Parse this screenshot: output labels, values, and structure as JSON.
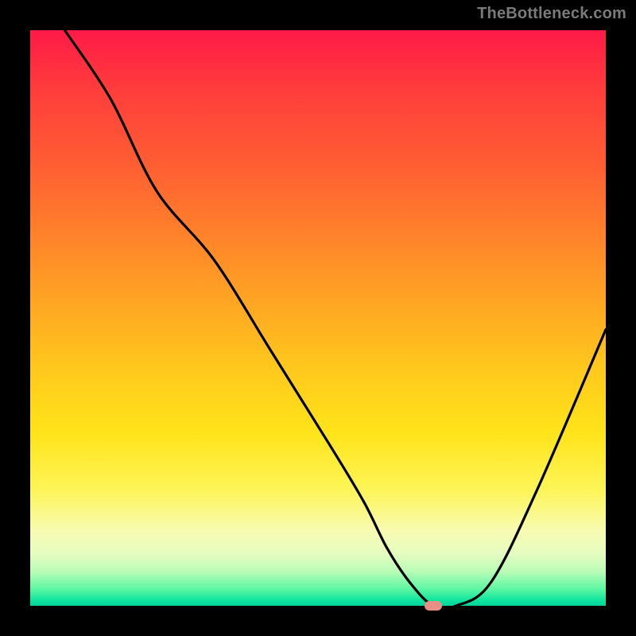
{
  "watermark": "TheBottleneck.com",
  "chart_data": {
    "type": "line",
    "title": "",
    "xlabel": "",
    "ylabel": "",
    "xlim": [
      0,
      100
    ],
    "ylim": [
      0,
      100
    ],
    "grid": false,
    "series": [
      {
        "name": "curve",
        "x": [
          6,
          14,
          22,
          32,
          42,
          52,
          58,
          62,
          66,
          70,
          74,
          80,
          88,
          100
        ],
        "values": [
          100,
          88,
          72,
          60,
          44,
          28,
          18,
          10,
          4,
          0,
          0,
          4,
          20,
          48
        ]
      }
    ],
    "marker": {
      "x": 70,
      "y": 0,
      "color": "#e78f85"
    },
    "colors": {
      "curve": "#000000",
      "bg_top": "#ff1a47",
      "bg_bottom": "#04d29c",
      "frame": "#000000"
    }
  }
}
